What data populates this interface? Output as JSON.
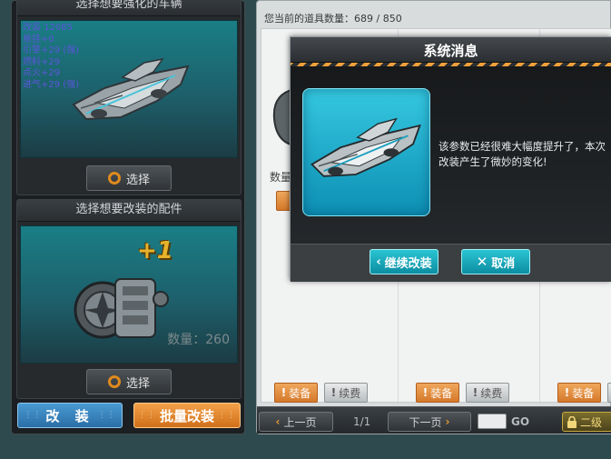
{
  "vehicle_section": {
    "title": "选择想要强化的车辆",
    "stats": [
      "改装 12085",
      "悬挂+0",
      "引擎+29 (强)",
      "燃料+29",
      "点火+29",
      "进气+29 (强)"
    ],
    "select_label": "选择"
  },
  "part_section": {
    "title": "选择想要改装的配件",
    "level_badge": "+1",
    "quantity": "数量：260",
    "select_label": "选择"
  },
  "actions": {
    "modify_label": "改 装",
    "batch_label": "批量改装"
  },
  "inventory": {
    "count_text": "您当前的道具数量：689 / 850",
    "ghost_quantity_label": "数量",
    "equip_label": "装备",
    "renew_label": "续费",
    "pager": {
      "prev_label": "上一页",
      "page_indicator": "1/1",
      "next_label": "下一页",
      "go_label": "GO",
      "lock_label": "二级"
    }
  },
  "modal": {
    "title": "系统消息",
    "message": "该参数已经很难大幅度提升了，本次改装产生了微妙的变化!",
    "continue_label": "继续改装",
    "cancel_label": "取消"
  },
  "colors": {
    "accent_orange": "#e08a1e",
    "accent_cyan": "#1fb3c8",
    "stat_text": "#5b56d8"
  }
}
